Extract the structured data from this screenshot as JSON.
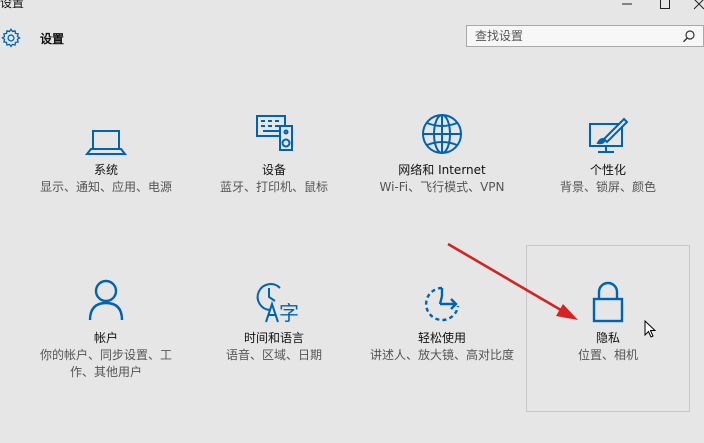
{
  "window": {
    "title": "设置"
  },
  "header": {
    "title": "设置"
  },
  "search": {
    "placeholder": "查找设置"
  },
  "colors": {
    "accent": "#0063b1",
    "background": "#e6e6e6",
    "annotation_arrow": "#d32323"
  },
  "tiles": [
    {
      "name": "系统",
      "desc": "显示、通知、应用、电源",
      "icon": "laptop-icon"
    },
    {
      "name": "设备",
      "desc": "蓝牙、打印机、鼠标",
      "icon": "devices-icon"
    },
    {
      "name": "网络和 Internet",
      "desc": "Wi-Fi、飞行模式、VPN",
      "icon": "globe-icon"
    },
    {
      "name": "个性化",
      "desc": "背景、锁屏、颜色",
      "icon": "personalization-icon"
    },
    {
      "name": "帐户",
      "desc": "你的帐户、同步设置、工作、其他用户",
      "icon": "person-icon"
    },
    {
      "name": "时间和语言",
      "desc": "语音、区域、日期",
      "icon": "time-language-icon"
    },
    {
      "name": "轻松使用",
      "desc": "讲述人、放大镜、高对比度",
      "icon": "ease-of-access-icon"
    },
    {
      "name": "隐私",
      "desc": "位置、相机",
      "icon": "lock-icon"
    }
  ]
}
